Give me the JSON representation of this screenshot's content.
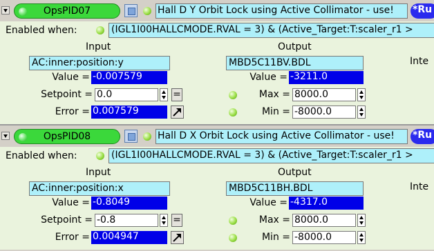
{
  "panels": [
    {
      "name": "OpsPID07",
      "title": "Hall D Y Orbit Lock using Active Collimator - use!",
      "run_badge": "*Ru",
      "enabled_label": "Enabled when:",
      "enabled_expr": "(IGL1I00HALLCMODE.RVAL = 3) & (Active_Target:T:scaler_r1 >",
      "input": {
        "title": "Input",
        "pv": "AC:inner:position:y",
        "value_label": "Value =",
        "value": "-0.007579",
        "setpoint_label": "Setpoint =",
        "setpoint": "0.0",
        "error_label": "Error =",
        "error": "0.007579",
        "eq_label": "="
      },
      "output": {
        "title": "Output",
        "pv": "MBD5C11BV.BDL",
        "value_label": "Value =",
        "value": "-3211.0",
        "max_label": "Max =",
        "max": "8000.0",
        "min_label": "Min =",
        "min": "-8000.0"
      },
      "inte": "Inte"
    },
    {
      "name": "OpsPID08",
      "title": "Hall D X Orbit Lock using Active Collimator - use!",
      "run_badge": "*Ru",
      "enabled_label": "Enabled when:",
      "enabled_expr": "(IGL1I00HALLCMODE.RVAL = 3) & (Active_Target:T:scaler_r1 >",
      "input": {
        "title": "Input",
        "pv": "AC:inner:position:x",
        "value_label": "Value =",
        "value": "-0.8049",
        "setpoint_label": "Setpoint =",
        "setpoint": "-0.8",
        "error_label": "Error =",
        "error": "0.004947",
        "eq_label": "="
      },
      "output": {
        "title": "Output",
        "pv": "MBD5C11BH.BDL",
        "value_label": "Value =",
        "value": "-4317.0",
        "max_label": "Max =",
        "max": "8000.0",
        "min_label": "Min =",
        "min": "-8000.0"
      },
      "inte": "Inte"
    }
  ],
  "colors": {
    "status_green": "#3bd83b",
    "pv_cyan": "#aef0fa",
    "readback_blue": "#0000e8",
    "panel_bg": "#eaf3dd"
  }
}
